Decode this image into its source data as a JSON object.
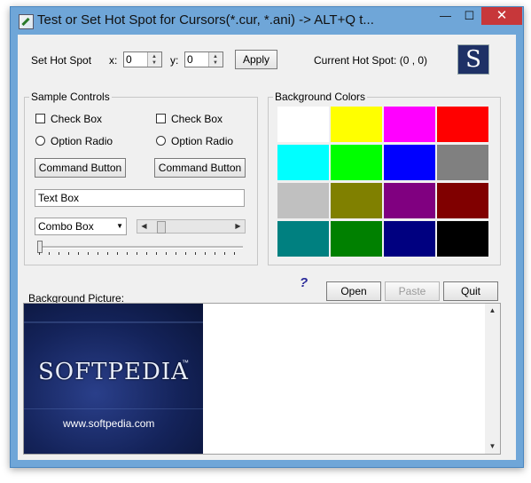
{
  "window": {
    "title": "Test or Set Hot Spot for Cursors(*.cur, *.ani)          -> ALT+Q t...",
    "minimize_glyph": "—",
    "maximize_glyph": "☐",
    "close_glyph": "✕"
  },
  "hotspot": {
    "set_label": "Set Hot Spot",
    "x_label": "x:",
    "x_value": "0",
    "y_label": "y:",
    "y_value": "0",
    "apply_label": "Apply",
    "current_label": "Current Hot Spot: (0 , 0)",
    "logo_letter": "S"
  },
  "sample_controls": {
    "title": "Sample Controls",
    "checkbox1": "Check Box",
    "checkbox2": "Check Box",
    "radio1": "Option Radio",
    "radio2": "Option Radio",
    "command1": "Command Button",
    "command2": "Command Button",
    "textbox_value": "Text Box",
    "combo_value": "Combo Box"
  },
  "background_colors": {
    "title": "Background Colors",
    "swatches": [
      "#ffffff",
      "#ffff00",
      "#ff00ff",
      "#ff0000",
      "#00ffff",
      "#00ff00",
      "#0000ff",
      "#808080",
      "#c0c0c0",
      "#808000",
      "#800080",
      "#800000",
      "#008080",
      "#008000",
      "#000080",
      "#000000"
    ]
  },
  "actions": {
    "help_glyph": "?",
    "open_label": "Open",
    "paste_label": "Paste",
    "quit_label": "Quit"
  },
  "background_picture": {
    "label": "Background Picture:",
    "brand": "SOFTPEDIA",
    "trademark": "™",
    "url": "www.softpedia.com"
  }
}
